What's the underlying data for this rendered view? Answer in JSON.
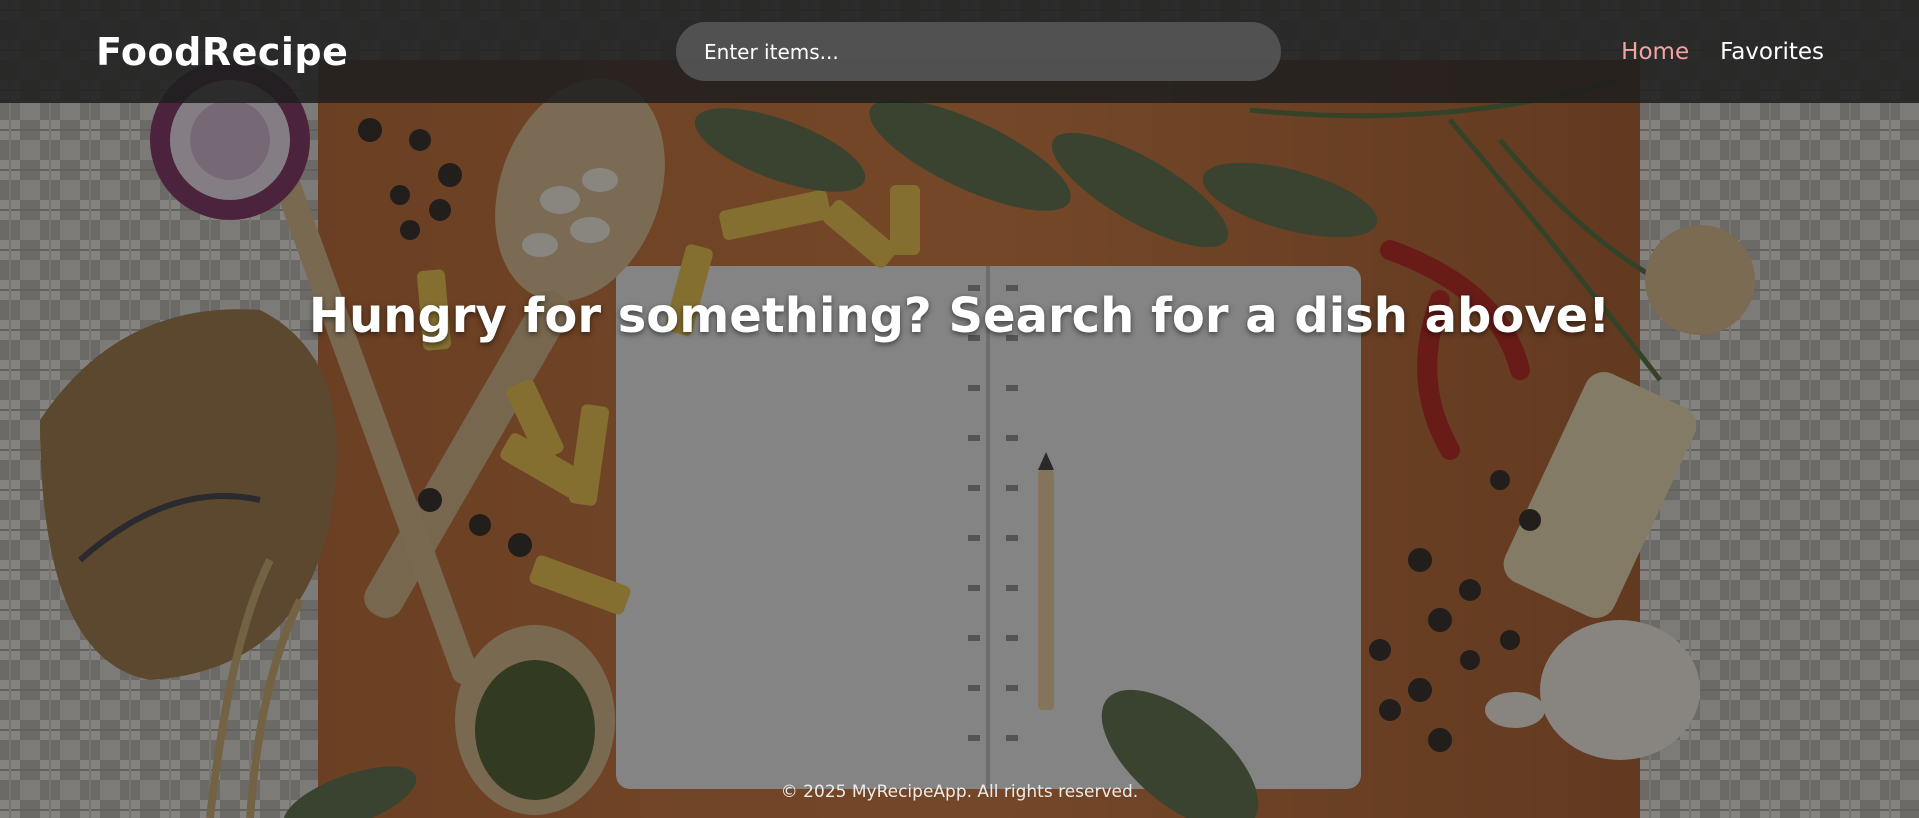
{
  "header": {
    "logo": "FoodRecipe",
    "search": {
      "placeholder": "Enter items...",
      "value": ""
    },
    "nav": [
      {
        "label": "Home",
        "active": true
      },
      {
        "label": "Favorites",
        "active": false
      }
    ]
  },
  "hero": {
    "title": "Hungry for something? Search for a dish above!"
  },
  "footer": {
    "text": "© 2025 MyRecipeApp. All rights reserved."
  },
  "colors": {
    "nav_active": "#f2a3a3",
    "text": "#ffffff",
    "navbar_bg": "#1e1e1e",
    "search_bg": "#555555"
  }
}
